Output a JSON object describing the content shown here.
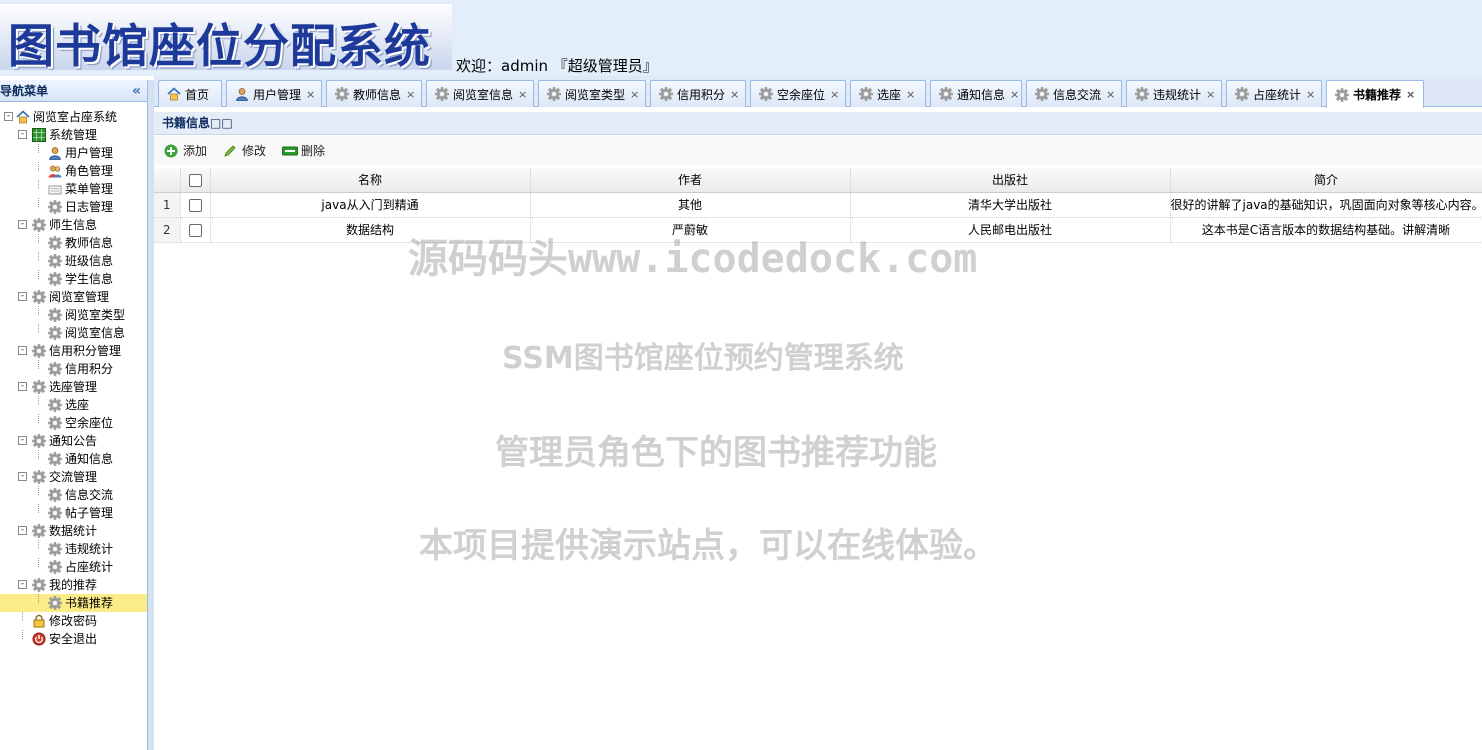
{
  "header": {
    "logo_text": "图书馆座位分配系统",
    "welcome": "欢迎：admin 『超级管理员』"
  },
  "sidebar": {
    "title": "导航菜单",
    "collapse_icon": "double-chevron-left-icon",
    "tree": [
      {
        "label": "阅览室占座系统",
        "level": 0,
        "icon": "home-icon",
        "toggle": "-"
      },
      {
        "label": "系统管理",
        "level": 1,
        "icon": "grid-icon",
        "toggle": "-"
      },
      {
        "label": "用户管理",
        "level": 2,
        "icon": "user-icon"
      },
      {
        "label": "角色管理",
        "level": 2,
        "icon": "users-icon"
      },
      {
        "label": "菜单管理",
        "level": 2,
        "icon": "menu-icon"
      },
      {
        "label": "日志管理",
        "level": 2,
        "icon": "gear-icon"
      },
      {
        "label": "师生信息",
        "level": 1,
        "icon": "gear-icon",
        "toggle": "-"
      },
      {
        "label": "教师信息",
        "level": 2,
        "icon": "gear-icon"
      },
      {
        "label": "班级信息",
        "level": 2,
        "icon": "gear-icon"
      },
      {
        "label": "学生信息",
        "level": 2,
        "icon": "gear-icon"
      },
      {
        "label": "阅览室管理",
        "level": 1,
        "icon": "gear-icon",
        "toggle": "-"
      },
      {
        "label": "阅览室类型",
        "level": 2,
        "icon": "gear-icon"
      },
      {
        "label": "阅览室信息",
        "level": 2,
        "icon": "gear-icon"
      },
      {
        "label": "信用积分管理",
        "level": 1,
        "icon": "gear-icon",
        "toggle": "-"
      },
      {
        "label": "信用积分",
        "level": 2,
        "icon": "gear-icon"
      },
      {
        "label": "选座管理",
        "level": 1,
        "icon": "gear-icon",
        "toggle": "-"
      },
      {
        "label": "选座",
        "level": 2,
        "icon": "gear-icon"
      },
      {
        "label": "空余座位",
        "level": 2,
        "icon": "gear-icon"
      },
      {
        "label": "通知公告",
        "level": 1,
        "icon": "gear-icon",
        "toggle": "-"
      },
      {
        "label": "通知信息",
        "level": 2,
        "icon": "gear-icon"
      },
      {
        "label": "交流管理",
        "level": 1,
        "icon": "gear-icon",
        "toggle": "-"
      },
      {
        "label": "信息交流",
        "level": 2,
        "icon": "gear-icon"
      },
      {
        "label": "帖子管理",
        "level": 2,
        "icon": "gear-icon"
      },
      {
        "label": "数据统计",
        "level": 1,
        "icon": "gear-icon",
        "toggle": "-"
      },
      {
        "label": "违规统计",
        "level": 2,
        "icon": "gear-icon"
      },
      {
        "label": "占座统计",
        "level": 2,
        "icon": "gear-icon"
      },
      {
        "label": "我的推荐",
        "level": 1,
        "icon": "gear-icon",
        "toggle": "-"
      },
      {
        "label": "书籍推荐",
        "level": 2,
        "icon": "gear-icon",
        "active": true
      },
      {
        "label": "修改密码",
        "level": 1,
        "icon": "lock-icon"
      },
      {
        "label": "安全退出",
        "level": 1,
        "icon": "power-icon"
      }
    ]
  },
  "tabs": [
    {
      "label": "首页",
      "icon": "home-icon",
      "closable": false
    },
    {
      "label": "用户管理",
      "icon": "user-icon",
      "closable": true
    },
    {
      "label": "教师信息",
      "icon": "gear-icon",
      "closable": true
    },
    {
      "label": "阅览室信息",
      "icon": "gear-icon",
      "closable": true
    },
    {
      "label": "阅览室类型",
      "icon": "gear-icon",
      "closable": true
    },
    {
      "label": "信用积分",
      "icon": "gear-icon",
      "closable": true
    },
    {
      "label": "空余座位",
      "icon": "gear-icon",
      "closable": true
    },
    {
      "label": "选座",
      "icon": "gear-icon",
      "closable": true
    },
    {
      "label": "通知信息",
      "icon": "gear-icon",
      "closable": true
    },
    {
      "label": "信息交流",
      "icon": "gear-icon",
      "closable": true
    },
    {
      "label": "违规统计",
      "icon": "gear-icon",
      "closable": true
    },
    {
      "label": "占座统计",
      "icon": "gear-icon",
      "closable": true
    },
    {
      "label": "书籍推荐",
      "icon": "gear-icon",
      "closable": true,
      "active": true
    }
  ],
  "tab_close_glyph": "×",
  "panel": {
    "title": "书籍信息□□"
  },
  "toolbar": {
    "add_label": "添加",
    "edit_label": "修改",
    "delete_label": "删除"
  },
  "table": {
    "columns": [
      "名称",
      "作者",
      "出版社",
      "简介"
    ],
    "rows": [
      {
        "num": "1",
        "cells": [
          "java从入门到精通",
          "其他",
          "清华大学出版社",
          "很好的讲解了java的基础知识，巩固面向对象等核心内容。"
        ]
      },
      {
        "num": "2",
        "cells": [
          "数据结构",
          "严蔚敏",
          "人民邮电出版社",
          "这本书是C语言版本的数据结构基础。讲解清晰"
        ]
      }
    ]
  },
  "watermarks": [
    "源码码头www.icodedock.com",
    "SSM图书馆座位预约管理系统",
    "管理员角色下的图书推荐功能",
    "本项目提供演示站点，可以在线体验。"
  ],
  "colors": {
    "accent": "#99bbe8",
    "active_tree": "#fbec88",
    "logo_text": "#1d3a9a"
  }
}
